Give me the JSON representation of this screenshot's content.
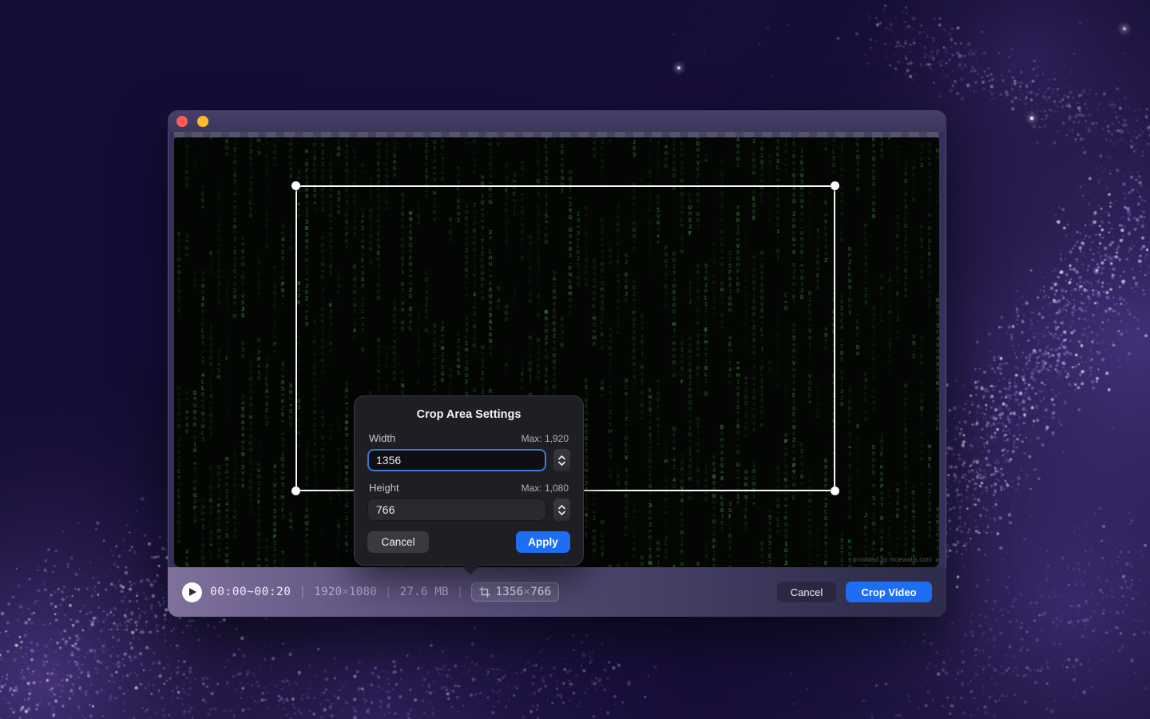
{
  "colors": {
    "accent_blue": "#1e6ef3",
    "focus_ring": "#3f79d2",
    "traffic_red": "#ff5d55",
    "traffic_yellow": "#fdbc2e",
    "matrix_green": "#55a060",
    "crop_border": "#ffffff"
  },
  "video": {
    "watermark": "provided by moewalls.com"
  },
  "popover": {
    "title": "Crop Area Settings",
    "width": {
      "label": "Width",
      "max": "Max: 1,920",
      "value": "1356"
    },
    "height": {
      "label": "Height",
      "max": "Max: 1,080",
      "value": "766"
    },
    "cancel_label": "Cancel",
    "apply_label": "Apply"
  },
  "toolbar": {
    "time_range": "00:00~00:20",
    "separator": "|",
    "resolution": {
      "w": "1920",
      "times": "×",
      "h": "1080"
    },
    "file_size": "27.6 MB",
    "crop_size": {
      "w": "1356",
      "times": "×",
      "h": "766"
    },
    "cancel_label": "Cancel",
    "crop_video_label": "Crop Video"
  }
}
